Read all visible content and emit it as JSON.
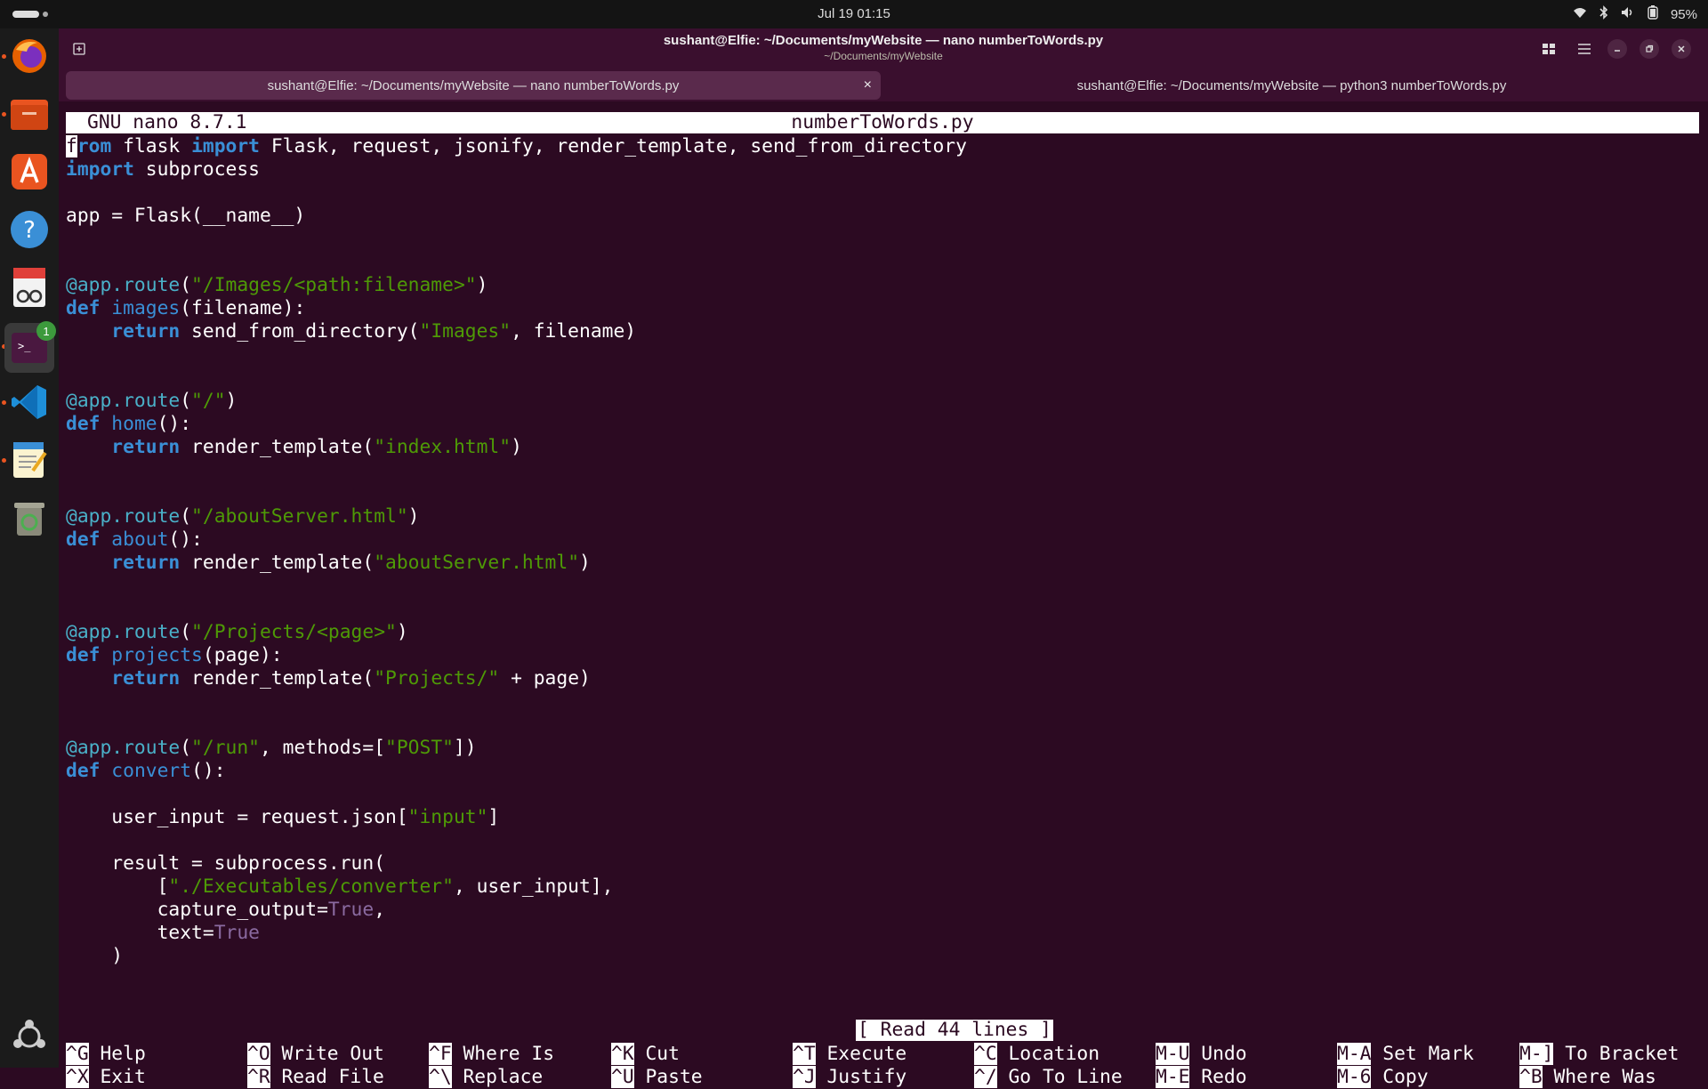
{
  "topbar": {
    "clock": "Jul 19  01:15",
    "battery": "95%",
    "icons": [
      "wifi-icon",
      "bluetooth-icon",
      "volume-icon",
      "battery-icon"
    ]
  },
  "dock": {
    "apps": [
      "firefox-icon",
      "files-icon",
      "app-center-icon",
      "help-icon",
      "document-viewer-icon",
      "terminal-icon",
      "vscode-icon",
      "text-editor-icon",
      "trash-icon",
      "show-apps-icon"
    ],
    "terminal_badge": "1"
  },
  "window": {
    "title": "sushant@Elfie: ~/Documents/myWebsite — nano numberToWords.py",
    "subtitle": "~/Documents/myWebsite",
    "tabs": [
      {
        "label": "sushant@Elfie: ~/Documents/myWebsite — nano numberToWords.py",
        "active": true
      },
      {
        "label": "sushant@Elfie: ~/Documents/myWebsite — python3 numberToWords.py",
        "active": false
      }
    ],
    "close_glyph": "×"
  },
  "nano": {
    "version": "GNU nano 8.7.1",
    "filename": "numberToWords.py",
    "status": "[ Read 44 lines ]",
    "code": [
      [
        [
          "kw",
          "f"
        ],
        [
          "kw",
          "rom"
        ],
        [
          "t",
          " flask "
        ],
        [
          "kw",
          "import"
        ],
        [
          "t",
          " Flask, request, jsonify, render_template, send_from_directory"
        ]
      ],
      [
        [
          "kw",
          "import"
        ],
        [
          "t",
          " subprocess"
        ]
      ],
      [],
      [
        [
          "t",
          "app = Flask(__name__)"
        ]
      ],
      [],
      [],
      [
        [
          "dec",
          "@app.route"
        ],
        [
          "t",
          "("
        ],
        [
          "str",
          "\"/Images/<path:filename>\""
        ],
        [
          "t",
          ")"
        ]
      ],
      [
        [
          "kw",
          "def"
        ],
        [
          "t",
          " "
        ],
        [
          "fn",
          "images"
        ],
        [
          "t",
          "(filename):"
        ]
      ],
      [
        [
          "t",
          "    "
        ],
        [
          "kw",
          "return"
        ],
        [
          "t",
          " send_from_directory("
        ],
        [
          "str",
          "\"Images\""
        ],
        [
          "t",
          ", filename)"
        ]
      ],
      [],
      [],
      [
        [
          "dec",
          "@app.route"
        ],
        [
          "t",
          "("
        ],
        [
          "str",
          "\"/\""
        ],
        [
          "t",
          ")"
        ]
      ],
      [
        [
          "kw",
          "def"
        ],
        [
          "t",
          " "
        ],
        [
          "fn",
          "home"
        ],
        [
          "t",
          "():"
        ]
      ],
      [
        [
          "t",
          "    "
        ],
        [
          "kw",
          "return"
        ],
        [
          "t",
          " render_template("
        ],
        [
          "str",
          "\"index.html\""
        ],
        [
          "t",
          ")"
        ]
      ],
      [],
      [],
      [
        [
          "dec",
          "@app.route"
        ],
        [
          "t",
          "("
        ],
        [
          "str",
          "\"/aboutServer.html\""
        ],
        [
          "t",
          ")"
        ]
      ],
      [
        [
          "kw",
          "def"
        ],
        [
          "t",
          " "
        ],
        [
          "fn",
          "about"
        ],
        [
          "t",
          "():"
        ]
      ],
      [
        [
          "t",
          "    "
        ],
        [
          "kw",
          "return"
        ],
        [
          "t",
          " render_template("
        ],
        [
          "str",
          "\"aboutServer.html\""
        ],
        [
          "t",
          ")"
        ]
      ],
      [],
      [],
      [
        [
          "dec",
          "@app.route"
        ],
        [
          "t",
          "("
        ],
        [
          "str",
          "\"/Projects/<page>\""
        ],
        [
          "t",
          ")"
        ]
      ],
      [
        [
          "kw",
          "def"
        ],
        [
          "t",
          " "
        ],
        [
          "fn",
          "projects"
        ],
        [
          "t",
          "(page):"
        ]
      ],
      [
        [
          "t",
          "    "
        ],
        [
          "kw",
          "return"
        ],
        [
          "t",
          " render_template("
        ],
        [
          "str",
          "\"Projects/\""
        ],
        [
          "t",
          " + page)"
        ]
      ],
      [],
      [],
      [
        [
          "dec",
          "@app.route"
        ],
        [
          "t",
          "("
        ],
        [
          "str",
          "\"/run\""
        ],
        [
          "t",
          ", methods=["
        ],
        [
          "str",
          "\"POST\""
        ],
        [
          "t",
          "])"
        ]
      ],
      [
        [
          "kw",
          "def"
        ],
        [
          "t",
          " "
        ],
        [
          "fn",
          "convert"
        ],
        [
          "t",
          "():"
        ]
      ],
      [],
      [
        [
          "t",
          "    user_input = request.json["
        ],
        [
          "str",
          "\"input\""
        ],
        [
          "t",
          "]"
        ]
      ],
      [],
      [
        [
          "t",
          "    result = subprocess.run("
        ]
      ],
      [
        [
          "t",
          "        ["
        ],
        [
          "str",
          "\"./Executables/converter\""
        ],
        [
          "t",
          ", user_input],"
        ]
      ],
      [
        [
          "t",
          "        capture_output="
        ],
        [
          "bool",
          "True"
        ],
        [
          "t",
          ","
        ]
      ],
      [
        [
          "t",
          "        text="
        ],
        [
          "bool",
          "True"
        ]
      ],
      [
        [
          "t",
          "    )"
        ]
      ]
    ],
    "shortcuts": [
      [
        {
          "key": "^G",
          "label": "Help"
        },
        {
          "key": "^X",
          "label": "Exit"
        }
      ],
      [
        {
          "key": "^O",
          "label": "Write Out"
        },
        {
          "key": "^R",
          "label": "Read File"
        }
      ],
      [
        {
          "key": "^F",
          "label": "Where Is"
        },
        {
          "key": "^\\",
          "label": "Replace"
        }
      ],
      [
        {
          "key": "^K",
          "label": "Cut"
        },
        {
          "key": "^U",
          "label": "Paste"
        }
      ],
      [
        {
          "key": "^T",
          "label": "Execute"
        },
        {
          "key": "^J",
          "label": "Justify"
        }
      ],
      [
        {
          "key": "^C",
          "label": "Location"
        },
        {
          "key": "^/",
          "label": "Go To Line"
        }
      ],
      [
        {
          "key": "M-U",
          "label": "Undo"
        },
        {
          "key": "M-E",
          "label": "Redo"
        }
      ],
      [
        {
          "key": "M-A",
          "label": "Set Mark"
        },
        {
          "key": "M-6",
          "label": "Copy"
        }
      ],
      [
        {
          "key": "M-]",
          "label": "To Bracket"
        },
        {
          "key": "^B",
          "label": "Where Was"
        }
      ]
    ]
  }
}
